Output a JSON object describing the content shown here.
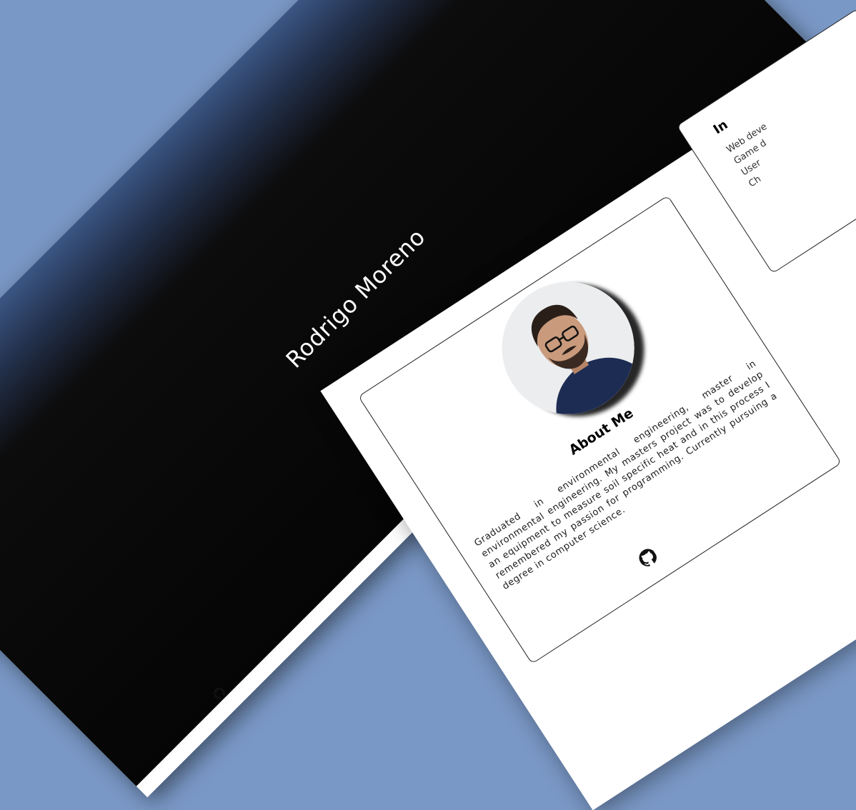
{
  "hero": {
    "name": "Rodrigo Moreno",
    "icons": [
      "linkedin-icon",
      "instagram-icon",
      "github-icon"
    ]
  },
  "about": {
    "title": "About Me",
    "text": "Graduated in environmental engineering, master in environmental engineering. My masters project was to develop an equipment to measure soil specific heat and in this process I remembered my passion for programming. Currently pursuing a degree in computer science.",
    "icon": "github-icon"
  },
  "interests": {
    "title": "In",
    "items": [
      "Web deve",
      "Game d",
      "User",
      "Ch"
    ]
  },
  "colors": {
    "background": "#7a98c6",
    "hero_dark": "#050505",
    "hero_top": "#3b5584"
  }
}
